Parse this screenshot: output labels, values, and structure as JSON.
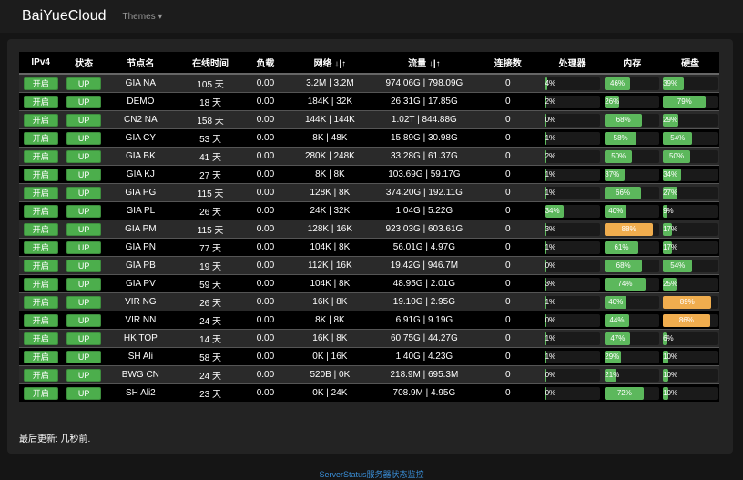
{
  "nav": {
    "brand": "BaiYueCloud",
    "themes": "Themes"
  },
  "table": {
    "headers": [
      "IPv4",
      "状态",
      "节点名",
      "在线时间",
      "负载",
      "网络 ↓|↑",
      "流量 ↓|↑",
      "连接数",
      "处理器",
      "内存",
      "硬盘"
    ],
    "rows": [
      [
        "开启",
        "UP",
        "GIA NA",
        "105 天",
        "0.00",
        "3.2M | 3.2M",
        "974.06G | 798.09G",
        "0",
        4,
        46,
        39
      ],
      [
        "开启",
        "UP",
        "DEMO",
        "18 天",
        "0.00",
        "184K | 32K",
        "26.31G | 17.85G",
        "0",
        2,
        26,
        79
      ],
      [
        "开启",
        "UP",
        "CN2 NA",
        "158 天",
        "0.00",
        "144K | 144K",
        "1.02T | 844.88G",
        "0",
        0,
        68,
        29
      ],
      [
        "开启",
        "UP",
        "GIA CY",
        "53 天",
        "0.00",
        "8K | 48K",
        "15.89G | 30.98G",
        "0",
        1,
        58,
        54
      ],
      [
        "开启",
        "UP",
        "GIA BK",
        "41 天",
        "0.00",
        "280K | 248K",
        "33.28G | 61.37G",
        "0",
        2,
        50,
        50
      ],
      [
        "开启",
        "UP",
        "GIA KJ",
        "27 天",
        "0.00",
        "8K | 8K",
        "103.69G | 59.17G",
        "0",
        1,
        37,
        34
      ],
      [
        "开启",
        "UP",
        "GIA PG",
        "115 天",
        "0.00",
        "128K | 8K",
        "374.20G | 192.11G",
        "0",
        1,
        66,
        27
      ],
      [
        "开启",
        "UP",
        "GIA PL",
        "26 天",
        "0.00",
        "24K | 32K",
        "1.04G | 5.22G",
        "0",
        34,
        40,
        9
      ],
      [
        "开启",
        "UP",
        "GIA PM",
        "115 天",
        "0.00",
        "128K | 16K",
        "923.03G | 603.61G",
        "0",
        3,
        88,
        17
      ],
      [
        "开启",
        "UP",
        "GIA PN",
        "77 天",
        "0.00",
        "104K | 8K",
        "56.01G | 4.97G",
        "0",
        1,
        61,
        17
      ],
      [
        "开启",
        "UP",
        "GIA PB",
        "19 天",
        "0.00",
        "112K | 16K",
        "19.42G | 946.7M",
        "0",
        0,
        68,
        54
      ],
      [
        "开启",
        "UP",
        "GIA PV",
        "59 天",
        "0.00",
        "104K | 8K",
        "48.95G | 2.01G",
        "0",
        3,
        74,
        25
      ],
      [
        "开启",
        "UP",
        "VIR NG",
        "26 天",
        "0.00",
        "16K | 8K",
        "19.10G | 2.95G",
        "0",
        1,
        40,
        89
      ],
      [
        "开启",
        "UP",
        "VIR NN",
        "24 天",
        "0.00",
        "8K | 8K",
        "6.91G | 9.19G",
        "0",
        0,
        44,
        86
      ],
      [
        "开启",
        "UP",
        "HK TOP",
        "14 天",
        "0.00",
        "16K | 8K",
        "60.75G | 44.27G",
        "0",
        1,
        47,
        6
      ],
      [
        "开启",
        "UP",
        "SH Ali",
        "58 天",
        "0.00",
        "0K | 16K",
        "1.40G | 4.23G",
        "0",
        1,
        29,
        10
      ],
      [
        "开启",
        "UP",
        "BWG CN",
        "24 天",
        "0.00",
        "520B | 0K",
        "218.9M | 695.3M",
        "0",
        0,
        21,
        10
      ],
      [
        "开启",
        "UP",
        "SH Ali2",
        "23 天",
        "0.00",
        "0K | 24K",
        "708.9M | 4.95G",
        "0",
        0,
        72,
        10
      ]
    ]
  },
  "updated": "最后更新: 几秒前.",
  "footer": "ServerStatus服务器状态监控",
  "colors": {
    "ok": "#5cb85c",
    "warn": "#f0ad4e",
    "link": "#3a8fd8"
  }
}
